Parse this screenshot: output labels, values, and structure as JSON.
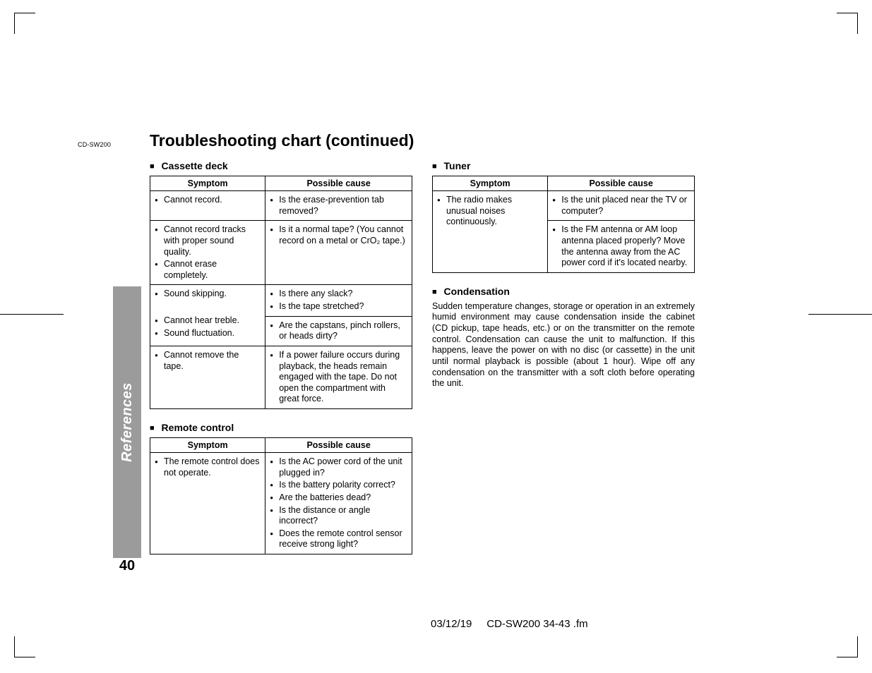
{
  "model_code": "CD-SW200",
  "page_title": "Troubleshooting chart (continued)",
  "side_tab": "References",
  "page_number": "40",
  "footer_date": "03/12/19",
  "footer_file": "CD-SW200 34-43 .fm",
  "col_symptom": "Symptom",
  "col_cause": "Possible cause",
  "sections": {
    "cassette": {
      "title": "Cassette deck",
      "rows": [
        {
          "s": [
            "Cannot record."
          ],
          "c": [
            "Is the erase-prevention tab removed?"
          ]
        },
        {
          "s": [
            "Cannot record tracks with proper sound quality.",
            "Cannot erase completely."
          ],
          "c": [
            "Is it a normal tape? (You cannot record on a metal or CrO₂ tape.)"
          ]
        },
        {
          "s": [
            "Sound skipping."
          ],
          "c": [
            "Is there any slack?",
            "Is the tape stretched?"
          ],
          "rowspan_s2": true
        },
        {
          "s": [
            "Cannot hear treble.",
            "Sound fluctuation."
          ],
          "c": [
            "Are the capstans, pinch rollers, or heads dirty?"
          ]
        },
        {
          "s": [
            "Cannot remove the tape."
          ],
          "c": [
            "If a power failure occurs during playback, the heads remain engaged with the tape. Do not open the compartment with great force."
          ]
        }
      ]
    },
    "remote": {
      "title": "Remote control",
      "rows": [
        {
          "s": [
            "The remote control does not operate."
          ],
          "c": [
            "Is the AC power cord of the unit plugged in?",
            "Is the battery polarity correct?",
            "Are the batteries dead?",
            "Is the distance or angle incorrect?",
            "Does the remote control sensor receive strong light?"
          ]
        }
      ]
    },
    "tuner": {
      "title": "Tuner",
      "rows": [
        {
          "s": [
            "The radio makes unusual noises continuously."
          ],
          "c": [
            "Is the unit placed near the TV or computer?",
            "Is the FM antenna or AM loop antenna placed properly? Move the antenna away from the AC power cord if it's located nearby."
          ]
        }
      ]
    },
    "condensation": {
      "title": "Condensation",
      "text": "Sudden temperature changes, storage or operation in an extremely humid environment may cause condensation inside the cabinet (CD pickup, tape heads, etc.) or on the transmitter on the remote control. Condensation can cause the unit to malfunction. If this happens, leave the power on with no disc (or cassette) in the unit until normal playback is possible (about 1 hour). Wipe off any condensation on the transmitter with a soft cloth before operating the unit."
    }
  }
}
